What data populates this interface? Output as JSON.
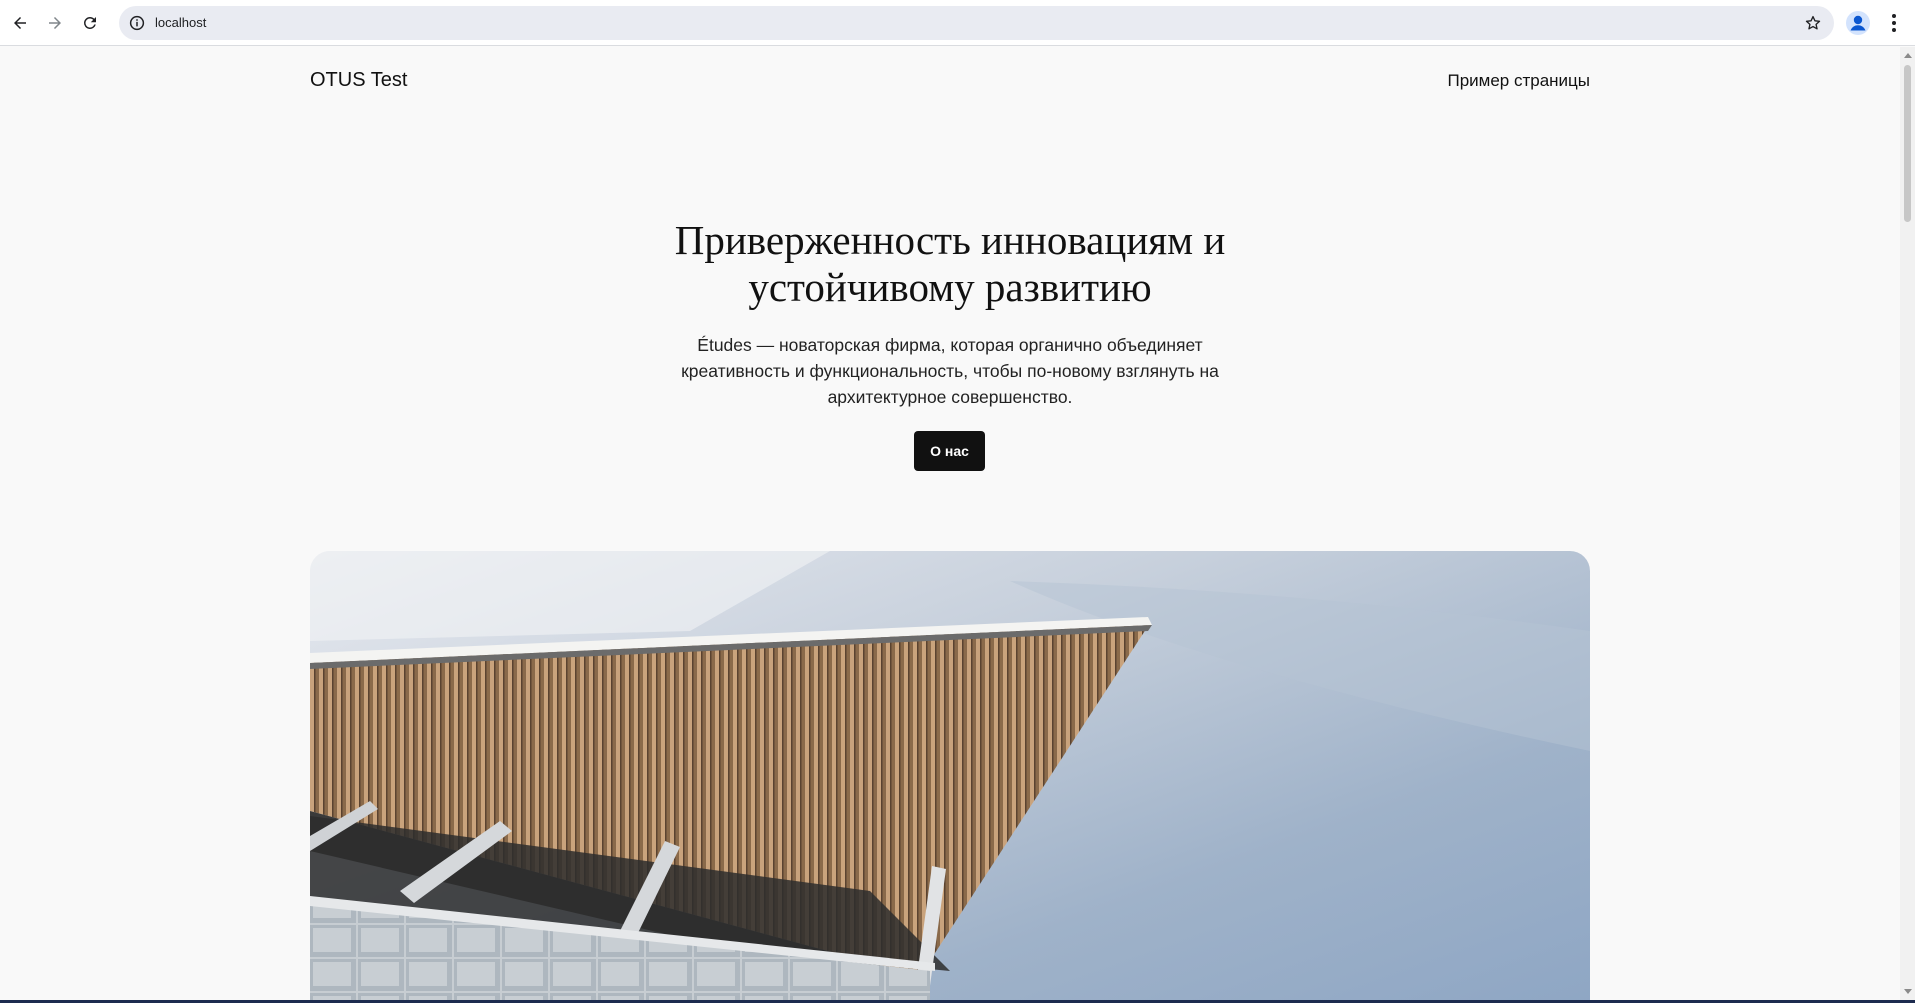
{
  "browser": {
    "url": "localhost"
  },
  "site": {
    "title": "OTUS Test",
    "nav_link": "Пример страницы"
  },
  "hero": {
    "heading": "Приверженность инновациям и устойчивому развитию",
    "text": "Études — новаторская фирма, которая органично объединяет креативность и функциональность, чтобы по-новому взглянуть на архитектурное совершенство.",
    "button_label": "О нас"
  }
}
